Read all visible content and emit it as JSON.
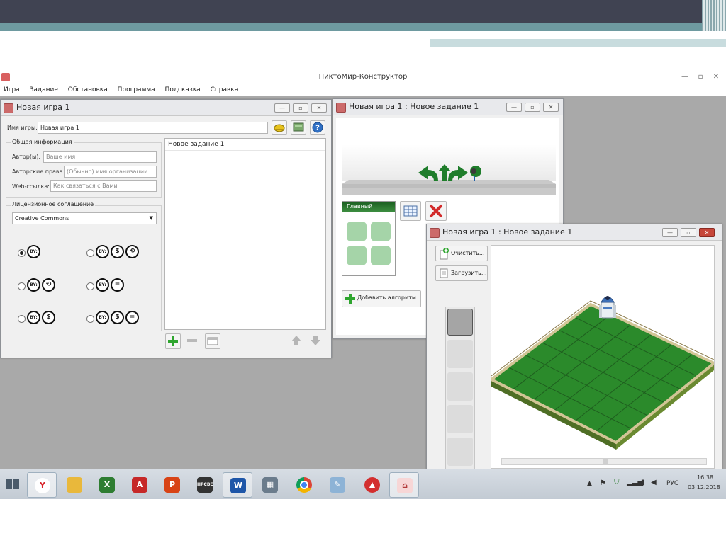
{
  "app": {
    "title": "ПиктоМир-Конструктор"
  },
  "menu": [
    "Игра",
    "Задание",
    "Обстановка",
    "Программа",
    "Подсказка",
    "Справка"
  ],
  "game_window": {
    "title": "Новая игра 1",
    "game_name_label": "Имя игры:",
    "game_name_value": "Новая игра 1",
    "general_info_legend": "Общая информация",
    "author_label": "Автор(ы):",
    "author_placeholder": "Ваше имя",
    "rights_label": "Авторские права:",
    "rights_placeholder": "(Обычно) имя организации",
    "web_label": "Web-ссылка:",
    "web_placeholder": "Как связаться с Вами",
    "license_legend": "Лицензионное соглашение",
    "license_value": "Creative Commons",
    "license_options": [
      {
        "icons": [
          "BY:"
        ],
        "selected": true
      },
      {
        "icons": [
          "BY:",
          "$",
          "⟲"
        ],
        "selected": false
      },
      {
        "icons": [
          "BY:",
          "⟲"
        ],
        "selected": false
      },
      {
        "icons": [
          "BY:",
          "="
        ],
        "selected": false
      },
      {
        "icons": [
          "BY:",
          "$"
        ],
        "selected": false
      },
      {
        "icons": [
          "BY:",
          "$",
          "="
        ],
        "selected": false
      }
    ],
    "tasks": [
      "Новое задание 1"
    ]
  },
  "task_window": {
    "title": "Новая игра 1 : Новое задание 1",
    "commands": [
      "turn-left",
      "forward",
      "turn-right",
      "paint"
    ],
    "algorithm_title": "Главный",
    "add_algorithm_label": "Добавить алгоритм..."
  },
  "env_window": {
    "title": "Новая игра 1 : Новое задание 1",
    "clear_label": "Очистить...",
    "load_label": "Загрузить...",
    "grid_cells": 36
  },
  "taskbar": {
    "apps": [
      "yandex-browser",
      "file-explorer",
      "excel",
      "acrobat",
      "powerpoint",
      "hpcbe",
      "word",
      "calculator",
      "chrome",
      "paint",
      "app-red",
      "piktomir"
    ],
    "hpcbe_label": "HPCBE",
    "lang": "РУС",
    "time": "16:38",
    "date": "03.12.2018"
  },
  "colors": {
    "slide_dark": "#404352",
    "slide_accent": "#6e9aa0",
    "grid_green": "#2f8f2f",
    "arrow_green": "#1f7d2b"
  }
}
